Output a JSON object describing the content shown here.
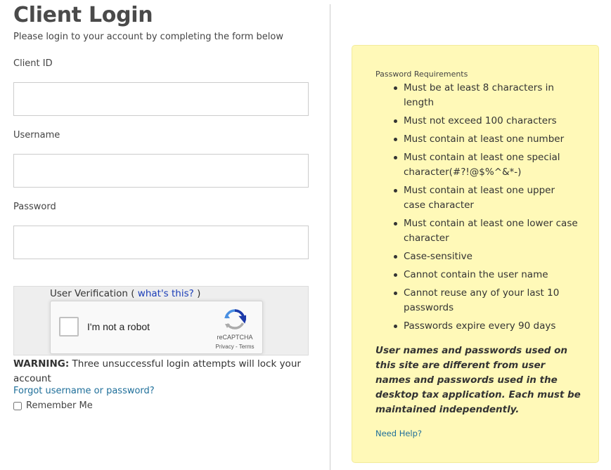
{
  "login": {
    "title": "Client Login",
    "subtitle": "Please login to your account by completing the form below",
    "client_id_label": "Client ID",
    "client_id_value": "",
    "username_label": "Username",
    "username_value": "",
    "password_label": "Password",
    "password_value": ""
  },
  "verification": {
    "label": "User Verification",
    "open_paren": "(",
    "link": "what's this?",
    "close_paren": ")",
    "recaptcha": {
      "checkbox_label": "I'm not a robot",
      "brand": "reCAPTCHA",
      "links": "Privacy - Terms",
      "icon": "recaptcha-logo-icon"
    }
  },
  "warning": {
    "prefix": "WARNING:",
    "text": "Three unsuccessful login attempts will lock your account"
  },
  "forgot_link": "Forgot username or password?",
  "remember_me": "Remember Me",
  "requirements": {
    "title": "Password Requirements",
    "items": [
      "Must be at least 8 characters in length",
      "Must not exceed 100 characters",
      "Must contain at least one number",
      "Must contain at least one special character(#?!@$%^&*-)",
      "Must contain at least one upper case character",
      "Must contain at least one lower case character",
      "Case-sensitive",
      "Cannot contain the user name",
      "Cannot reuse any of your last 10 passwords",
      "Passwords expire every 90 days"
    ],
    "note": "User names and passwords used on this site are different from user names and passwords used in the desktop tax application. Each must be maintained independently.",
    "help_link": "Need Help?"
  },
  "colors": {
    "panel_background": "#fff9b8",
    "link": "#1f6f9a",
    "verify_link": "#1a3db8"
  }
}
